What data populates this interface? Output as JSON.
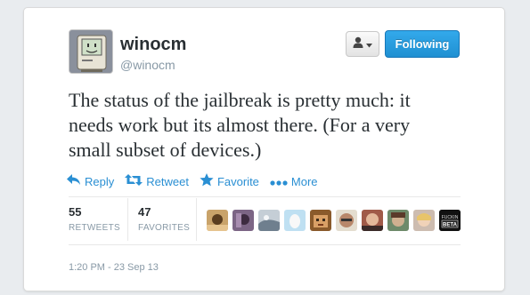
{
  "user": {
    "name": "winocm",
    "handle": "@winocm"
  },
  "follow_button": {
    "label": "Following"
  },
  "tweet": {
    "line1": "The status of the jailbreak is pretty much: it",
    "line2": "needs work but its almost there. (For a very",
    "line3": "small subset of devices.)"
  },
  "actions": {
    "reply": "Reply",
    "retweet": "Retweet",
    "favorite": "Favorite",
    "more": "More"
  },
  "stats": {
    "retweets": {
      "count": "55",
      "label": "RETWEETS"
    },
    "favorites": {
      "count": "47",
      "label": "FAVORITES"
    }
  },
  "favoriters": [
    {
      "icon": "avatar-1"
    },
    {
      "icon": "avatar-2"
    },
    {
      "icon": "avatar-3"
    },
    {
      "icon": "avatar-4"
    },
    {
      "icon": "avatar-5"
    },
    {
      "icon": "avatar-6"
    },
    {
      "icon": "avatar-7"
    },
    {
      "icon": "avatar-8"
    },
    {
      "icon": "avatar-9"
    },
    {
      "icon": "avatar-10",
      "text_line1": "FUCKIN",
      "text_line2": "BETA"
    }
  ],
  "timestamp": "1:20 PM - 23 Sep 13",
  "colors": {
    "link": "#2a8fd3",
    "follow_button": "#1f90d2",
    "text": "#292f33",
    "muted": "#8899a6"
  }
}
